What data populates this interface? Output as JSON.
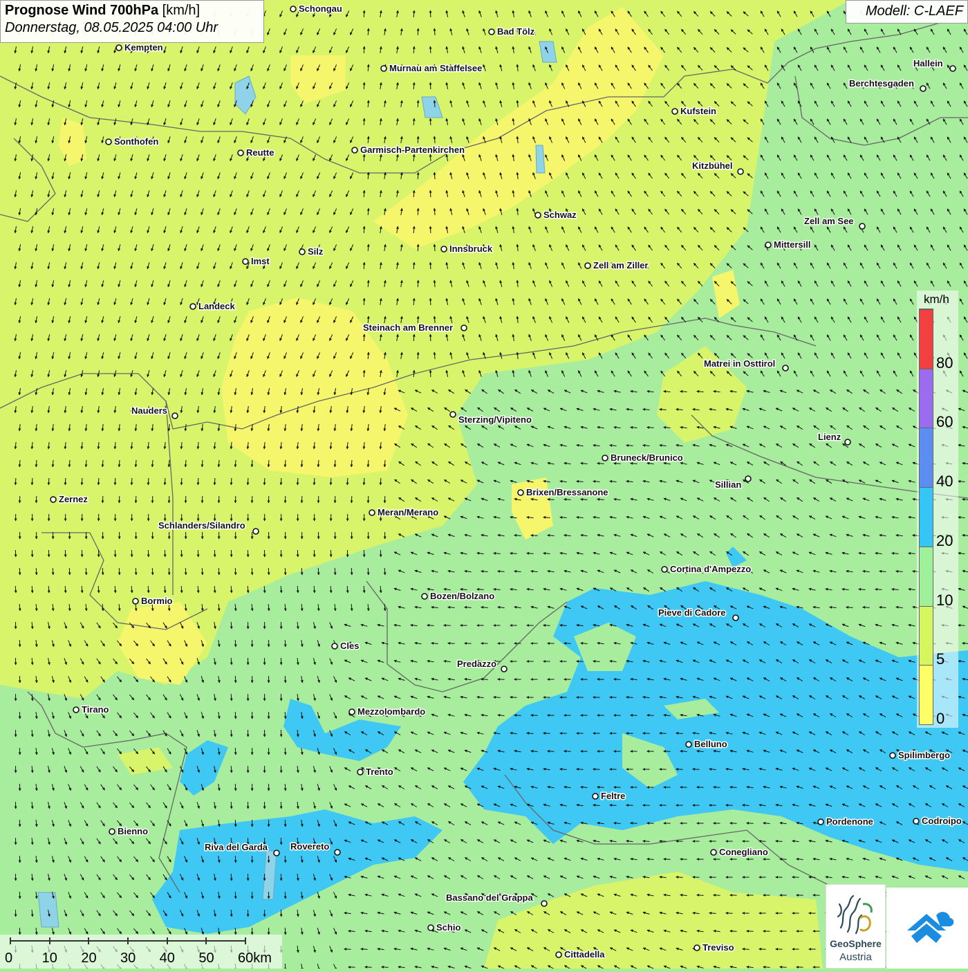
{
  "header": {
    "title_bold": "Prognose Wind 700hPa",
    "title_unit": "[km/h]",
    "datetime": "Donnerstag, 08.05.2025 04:00 Uhr",
    "model": "Modell: C-LAEF"
  },
  "legend": {
    "unit": "km/h",
    "bands": [
      {
        "label": "0",
        "color": "#ffff66"
      },
      {
        "label": "5",
        "color": "#d6f55e"
      },
      {
        "label": "10",
        "color": "#9ff09a"
      },
      {
        "label": "20",
        "color": "#35c6f5"
      },
      {
        "label": "40",
        "color": "#5b8ef0"
      },
      {
        "label": "60",
        "color": "#9b6cf0"
      },
      {
        "label": "80",
        "color": "#f04040"
      }
    ]
  },
  "scalebar": {
    "labels": [
      "0",
      "10",
      "20",
      "30",
      "40",
      "50",
      "60km"
    ]
  },
  "logos": {
    "geosphere_line1": "GeoSphere",
    "geosphere_line2": "Austria"
  },
  "map": {
    "cities": [
      {
        "name": "Schongau"
      },
      {
        "name": "Kempten"
      },
      {
        "name": "Bad Tölz"
      },
      {
        "name": "Murnau am Staffelsee"
      },
      {
        "name": "Hallein"
      },
      {
        "name": "Berchtesgaden"
      },
      {
        "name": "Kufstein"
      },
      {
        "name": "Sonthofen"
      },
      {
        "name": "Reutte"
      },
      {
        "name": "Garmisch-Partenkirchen"
      },
      {
        "name": "Kitzbühel"
      },
      {
        "name": "Schwaz"
      },
      {
        "name": "Zell am See"
      },
      {
        "name": "Mittersill"
      },
      {
        "name": "Silz"
      },
      {
        "name": "Innsbruck"
      },
      {
        "name": "Imst"
      },
      {
        "name": "Zell am Ziller"
      },
      {
        "name": "Landeck"
      },
      {
        "name": "Steinach am Brenner"
      },
      {
        "name": "Matrei in Osttirol"
      },
      {
        "name": "Nauders"
      },
      {
        "name": "Sterzing/Vipiteno"
      },
      {
        "name": "Lienz"
      },
      {
        "name": "Bruneck/Brunico"
      },
      {
        "name": "Sillian"
      },
      {
        "name": "Brixen/Bressanone"
      },
      {
        "name": "Zernez"
      },
      {
        "name": "Meran/Merano"
      },
      {
        "name": "Schlanders/Silandro"
      },
      {
        "name": "Cortina d'Ampezzo"
      },
      {
        "name": "Bozen/Bolzano"
      },
      {
        "name": "Bormio"
      },
      {
        "name": "Pieve di Cadore"
      },
      {
        "name": "Cles"
      },
      {
        "name": "Predazzo"
      },
      {
        "name": "Tirano"
      },
      {
        "name": "Mezzolombardo"
      },
      {
        "name": "Belluno"
      },
      {
        "name": "Spilimbergo"
      },
      {
        "name": "Trento"
      },
      {
        "name": "Feltre"
      },
      {
        "name": "Pordenone"
      },
      {
        "name": "Codroipo"
      },
      {
        "name": "Bienno"
      },
      {
        "name": "Riva del Garda"
      },
      {
        "name": "Rovereto"
      },
      {
        "name": "Conegliano"
      },
      {
        "name": "Bassano del Grappa"
      },
      {
        "name": "Schio"
      },
      {
        "name": "Treviso"
      },
      {
        "name": "Cittadella"
      }
    ]
  }
}
